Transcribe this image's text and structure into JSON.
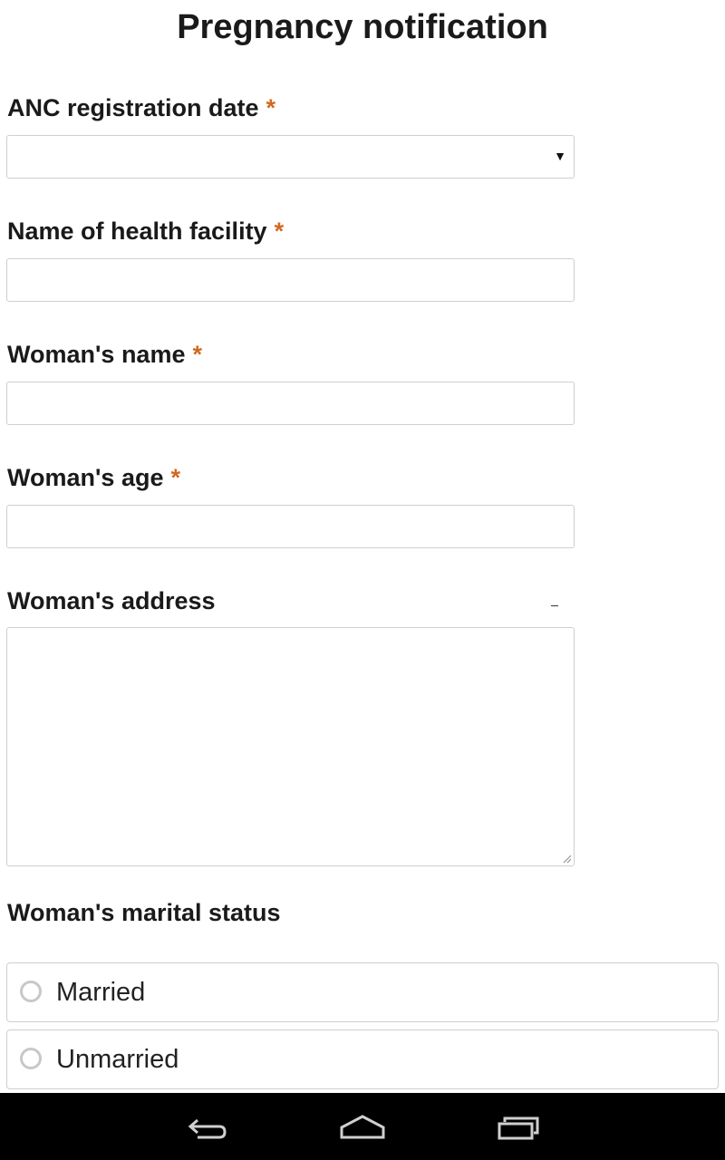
{
  "form": {
    "title": "Pregnancy notification",
    "required_marker": "*",
    "fields": {
      "anc_registration_date": {
        "label": "ANC registration date",
        "value": "",
        "dropdown_icon": "caret-down-icon"
      },
      "health_facility": {
        "label": "Name of health facility",
        "value": ""
      },
      "woman_name": {
        "label": "Woman's name",
        "value": ""
      },
      "woman_age": {
        "label": "Woman's age",
        "value": ""
      },
      "woman_address": {
        "label": "Woman's address",
        "value": ""
      },
      "marital_status": {
        "label": "Woman's marital status",
        "options": [
          "Married",
          "Unmarried"
        ]
      }
    }
  },
  "navbar": {
    "icons": [
      "back-icon",
      "home-icon",
      "recent-apps-icon"
    ],
    "background": "#000000"
  },
  "colors": {
    "required": "#d2691e",
    "border": "#cfcfcf",
    "radio_border": "#c8c8c8"
  }
}
